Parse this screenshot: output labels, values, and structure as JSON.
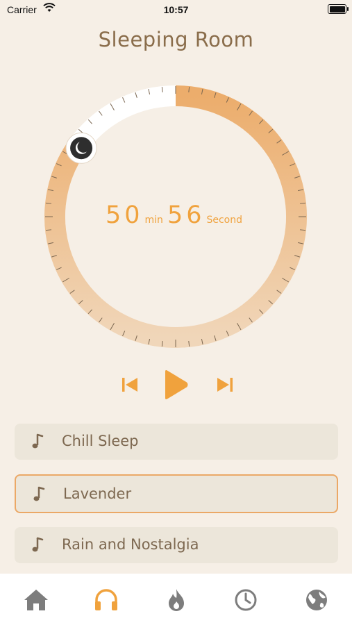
{
  "status_bar": {
    "carrier": "Carrier",
    "time": "10:57"
  },
  "title": "Sleeping Room",
  "timer": {
    "minutes": "50",
    "minutes_unit": "min",
    "seconds": "56",
    "seconds_unit": "Second",
    "progress_fraction": 0.85
  },
  "colors": {
    "accent": "#f0a23d",
    "background": "#f6efe6",
    "text_brown": "#8a6d4b"
  },
  "controls": {
    "previous_icon": "skip-previous-icon",
    "play_icon": "play-icon",
    "next_icon": "skip-next-icon"
  },
  "tracks": [
    {
      "label": "Chill Sleep",
      "icon": "music-note-icon",
      "selected": false
    },
    {
      "label": "Lavender",
      "icon": "music-note-icon",
      "selected": true
    },
    {
      "label": "Rain and Nostalgia",
      "icon": "music-note-icon",
      "selected": false
    }
  ],
  "tabbar": [
    {
      "icon": "home-icon",
      "active": false
    },
    {
      "icon": "headphones-icon",
      "active": true
    },
    {
      "icon": "flame-icon",
      "active": false
    },
    {
      "icon": "clock-icon",
      "active": false
    },
    {
      "icon": "globe-icon",
      "active": false
    }
  ]
}
